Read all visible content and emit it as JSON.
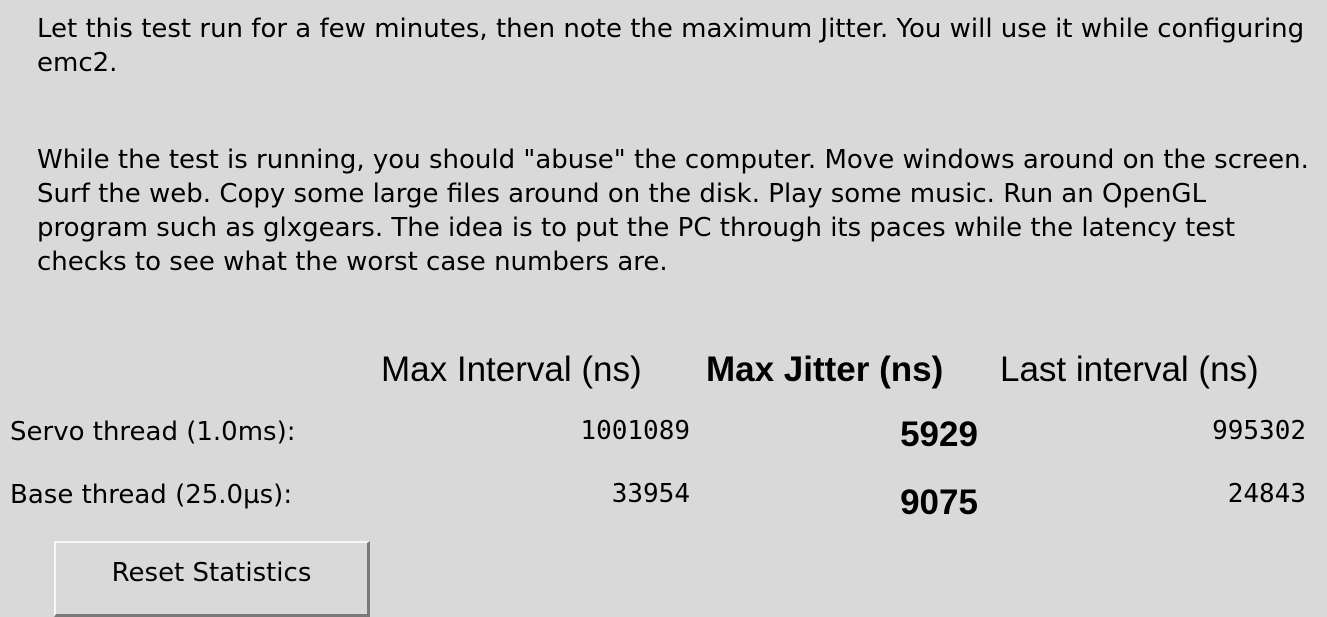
{
  "instructions": {
    "paragraph1": "Let this test run for a few minutes, then note the maximum Jitter.  You will use it while configuring emc2.",
    "paragraph2": "While the test is running, you should \"abuse\" the computer. Move windows around on the screen. Surf the web. Copy some large files around on the disk. Play some music. Run an OpenGL program such as glxgears. The idea is to put the PC through its paces while the latency test checks to see what the worst case numbers are."
  },
  "table": {
    "headers": {
      "max_interval": "Max Interval (ns)",
      "max_jitter": "Max Jitter (ns)",
      "last_interval": "Last interval (ns)"
    },
    "rows": [
      {
        "label": "Servo thread (1.0ms):",
        "max_interval": "1001089",
        "max_jitter": "5929",
        "last_interval": "995302"
      },
      {
        "label": "Base thread (25.0µs):",
        "max_interval": "33954",
        "max_jitter": "9075",
        "last_interval": "24843"
      }
    ]
  },
  "buttons": {
    "reset_label": "Reset Statistics"
  },
  "colors": {
    "background": "#d9d9d9",
    "text": "#000000"
  }
}
